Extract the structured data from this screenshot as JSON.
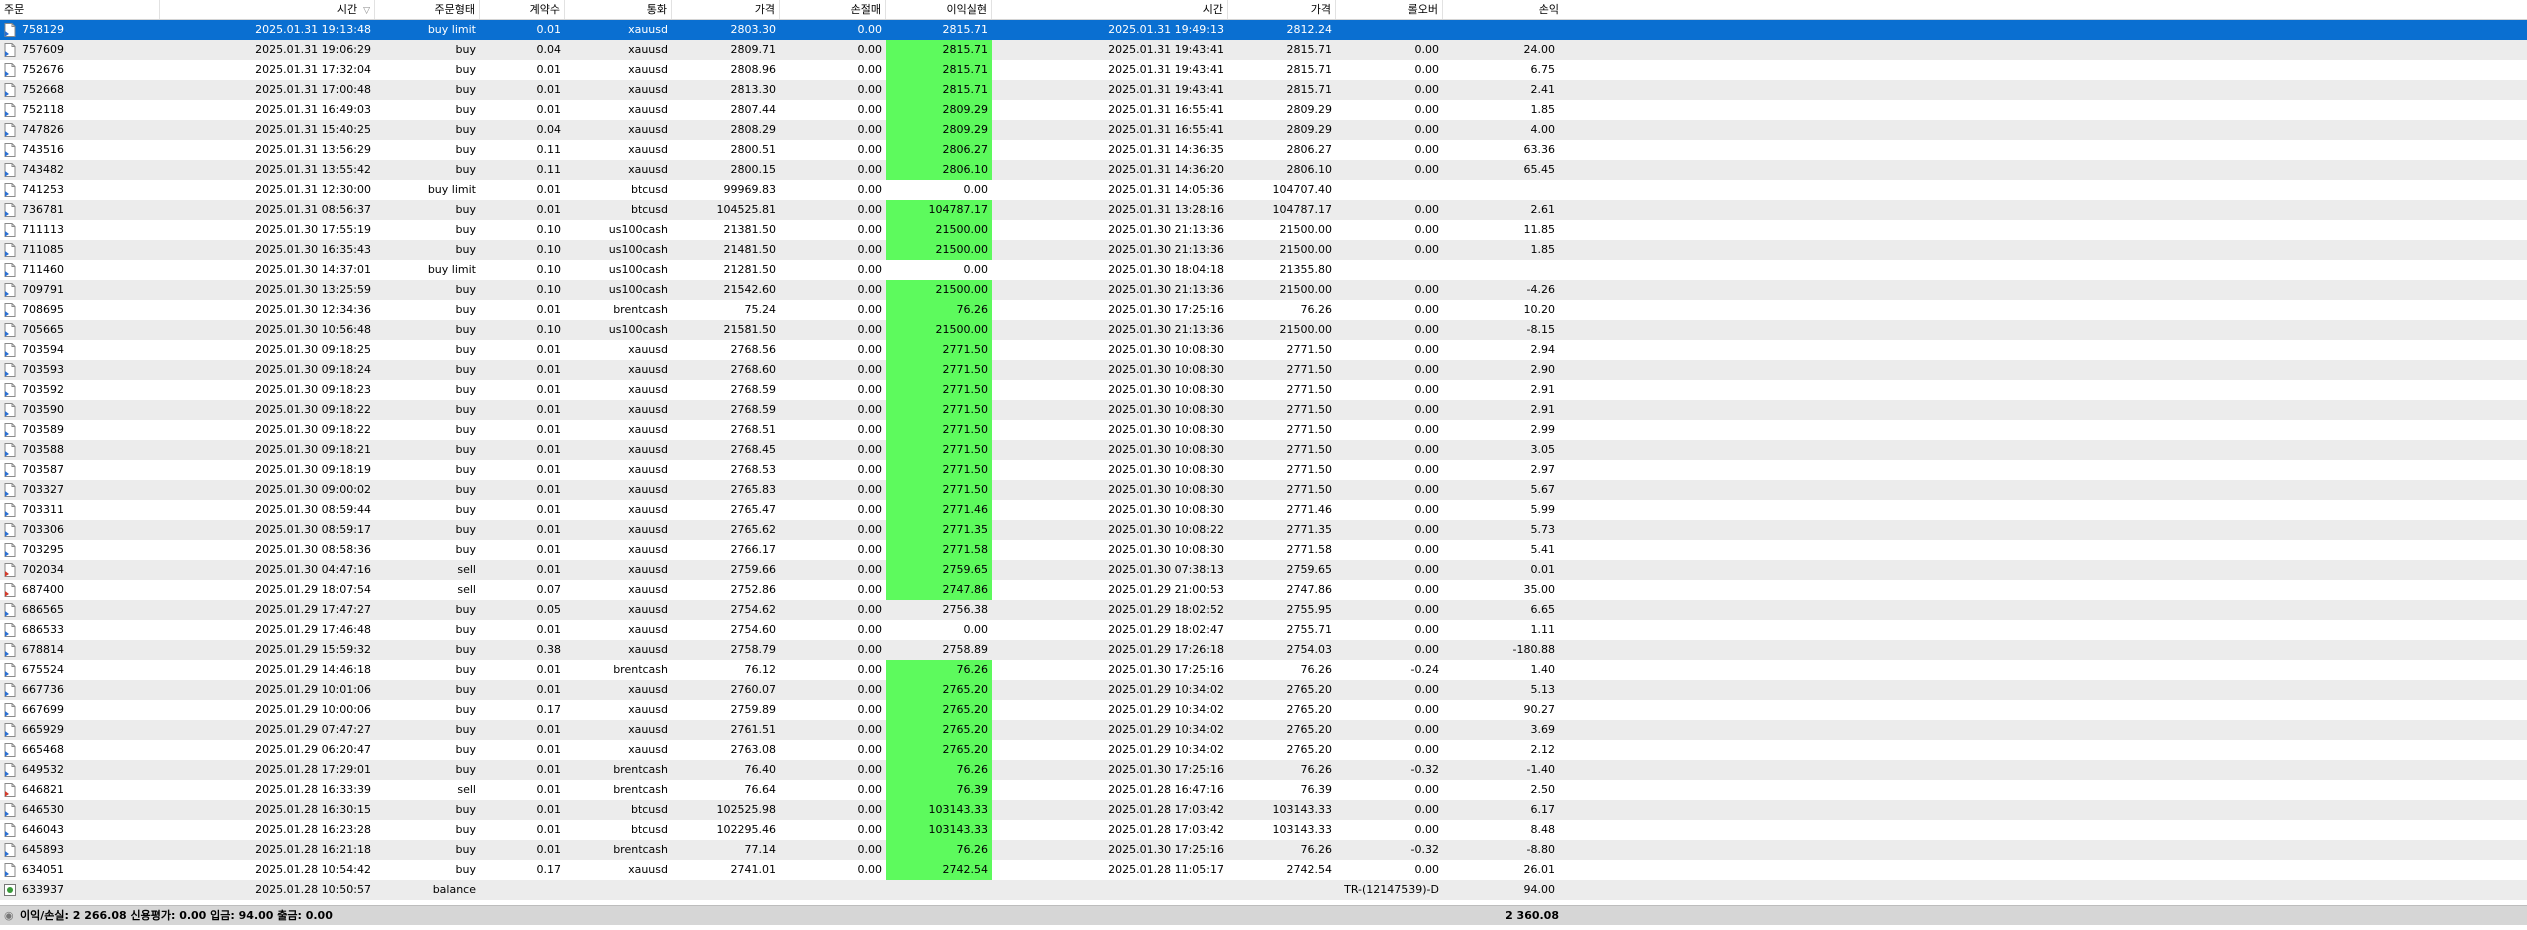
{
  "colors": {
    "selected": "#0a6fd1",
    "highlight": "#5dfa5d"
  },
  "headers": {
    "order": "주문",
    "time": "시간",
    "type": "주문형태",
    "volume": "계약수",
    "symbol": "통화",
    "price": "가격",
    "sl": "손절매",
    "tp": "이익실현",
    "close_time": "시간",
    "close_price": "가격",
    "swap": "롤오버",
    "profit": "손익"
  },
  "rows": [
    {
      "icon": "buy",
      "order": "758129",
      "time": "2025.01.31 19:13:48",
      "type": "buy limit",
      "volume": "0.01",
      "symbol": "xauusd",
      "price": "2803.30",
      "sl": "0.00",
      "tp": "2815.71",
      "tp_hl": true,
      "ct": "2025.01.31 19:49:13",
      "cp": "2812.24",
      "swap": "",
      "profit": "",
      "selected": true
    },
    {
      "icon": "buy",
      "order": "757609",
      "time": "2025.01.31 19:06:29",
      "type": "buy",
      "volume": "0.04",
      "symbol": "xauusd",
      "price": "2809.71",
      "sl": "0.00",
      "tp": "2815.71",
      "tp_hl": true,
      "ct": "2025.01.31 19:43:41",
      "cp": "2815.71",
      "swap": "0.00",
      "profit": "24.00"
    },
    {
      "icon": "buy",
      "order": "752676",
      "time": "2025.01.31 17:32:04",
      "type": "buy",
      "volume": "0.01",
      "symbol": "xauusd",
      "price": "2808.96",
      "sl": "0.00",
      "tp": "2815.71",
      "tp_hl": true,
      "ct": "2025.01.31 19:43:41",
      "cp": "2815.71",
      "swap": "0.00",
      "profit": "6.75"
    },
    {
      "icon": "buy",
      "order": "752668",
      "time": "2025.01.31 17:00:48",
      "type": "buy",
      "volume": "0.01",
      "symbol": "xauusd",
      "price": "2813.30",
      "sl": "0.00",
      "tp": "2815.71",
      "tp_hl": true,
      "ct": "2025.01.31 19:43:41",
      "cp": "2815.71",
      "swap": "0.00",
      "profit": "2.41"
    },
    {
      "icon": "buy",
      "order": "752118",
      "time": "2025.01.31 16:49:03",
      "type": "buy",
      "volume": "0.01",
      "symbol": "xauusd",
      "price": "2807.44",
      "sl": "0.00",
      "tp": "2809.29",
      "tp_hl": true,
      "ct": "2025.01.31 16:55:41",
      "cp": "2809.29",
      "swap": "0.00",
      "profit": "1.85"
    },
    {
      "icon": "buy",
      "order": "747826",
      "time": "2025.01.31 15:40:25",
      "type": "buy",
      "volume": "0.04",
      "symbol": "xauusd",
      "price": "2808.29",
      "sl": "0.00",
      "tp": "2809.29",
      "tp_hl": true,
      "ct": "2025.01.31 16:55:41",
      "cp": "2809.29",
      "swap": "0.00",
      "profit": "4.00"
    },
    {
      "icon": "buy",
      "order": "743516",
      "time": "2025.01.31 13:56:29",
      "type": "buy",
      "volume": "0.11",
      "symbol": "xauusd",
      "price": "2800.51",
      "sl": "0.00",
      "tp": "2806.27",
      "tp_hl": true,
      "ct": "2025.01.31 14:36:35",
      "cp": "2806.27",
      "swap": "0.00",
      "profit": "63.36"
    },
    {
      "icon": "buy",
      "order": "743482",
      "time": "2025.01.31 13:55:42",
      "type": "buy",
      "volume": "0.11",
      "symbol": "xauusd",
      "price": "2800.15",
      "sl": "0.00",
      "tp": "2806.10",
      "tp_hl": true,
      "ct": "2025.01.31 14:36:20",
      "cp": "2806.10",
      "swap": "0.00",
      "profit": "65.45"
    },
    {
      "icon": "buy",
      "order": "741253",
      "time": "2025.01.31 12:30:00",
      "type": "buy limit",
      "volume": "0.01",
      "symbol": "btcusd",
      "price": "99969.83",
      "sl": "0.00",
      "tp": "0.00",
      "tp_hl": false,
      "ct": "2025.01.31 14:05:36",
      "cp": "104707.40",
      "swap": "",
      "profit": ""
    },
    {
      "icon": "buy",
      "order": "736781",
      "time": "2025.01.31 08:56:37",
      "type": "buy",
      "volume": "0.01",
      "symbol": "btcusd",
      "price": "104525.81",
      "sl": "0.00",
      "tp": "104787.17",
      "tp_hl": true,
      "ct": "2025.01.31 13:28:16",
      "cp": "104787.17",
      "swap": "0.00",
      "profit": "2.61"
    },
    {
      "icon": "buy",
      "order": "711113",
      "time": "2025.01.30 17:55:19",
      "type": "buy",
      "volume": "0.10",
      "symbol": "us100cash",
      "price": "21381.50",
      "sl": "0.00",
      "tp": "21500.00",
      "tp_hl": true,
      "ct": "2025.01.30 21:13:36",
      "cp": "21500.00",
      "swap": "0.00",
      "profit": "11.85"
    },
    {
      "icon": "buy",
      "order": "711085",
      "time": "2025.01.30 16:35:43",
      "type": "buy",
      "volume": "0.10",
      "symbol": "us100cash",
      "price": "21481.50",
      "sl": "0.00",
      "tp": "21500.00",
      "tp_hl": true,
      "ct": "2025.01.30 21:13:36",
      "cp": "21500.00",
      "swap": "0.00",
      "profit": "1.85"
    },
    {
      "icon": "buy",
      "order": "711460",
      "time": "2025.01.30 14:37:01",
      "type": "buy limit",
      "volume": "0.10",
      "symbol": "us100cash",
      "price": "21281.50",
      "sl": "0.00",
      "tp": "0.00",
      "tp_hl": false,
      "ct": "2025.01.30 18:04:18",
      "cp": "21355.80",
      "swap": "",
      "profit": ""
    },
    {
      "icon": "buy",
      "order": "709791",
      "time": "2025.01.30 13:25:59",
      "type": "buy",
      "volume": "0.10",
      "symbol": "us100cash",
      "price": "21542.60",
      "sl": "0.00",
      "tp": "21500.00",
      "tp_hl": true,
      "ct": "2025.01.30 21:13:36",
      "cp": "21500.00",
      "swap": "0.00",
      "profit": "-4.26"
    },
    {
      "icon": "buy",
      "order": "708695",
      "time": "2025.01.30 12:34:36",
      "type": "buy",
      "volume": "0.01",
      "symbol": "brentcash",
      "price": "75.24",
      "sl": "0.00",
      "tp": "76.26",
      "tp_hl": true,
      "ct": "2025.01.30 17:25:16",
      "cp": "76.26",
      "swap": "0.00",
      "profit": "10.20"
    },
    {
      "icon": "buy",
      "order": "705665",
      "time": "2025.01.30 10:56:48",
      "type": "buy",
      "volume": "0.10",
      "symbol": "us100cash",
      "price": "21581.50",
      "sl": "0.00",
      "tp": "21500.00",
      "tp_hl": true,
      "ct": "2025.01.30 21:13:36",
      "cp": "21500.00",
      "swap": "0.00",
      "profit": "-8.15"
    },
    {
      "icon": "buy",
      "order": "703594",
      "time": "2025.01.30 09:18:25",
      "type": "buy",
      "volume": "0.01",
      "symbol": "xauusd",
      "price": "2768.56",
      "sl": "0.00",
      "tp": "2771.50",
      "tp_hl": true,
      "ct": "2025.01.30 10:08:30",
      "cp": "2771.50",
      "swap": "0.00",
      "profit": "2.94"
    },
    {
      "icon": "buy",
      "order": "703593",
      "time": "2025.01.30 09:18:24",
      "type": "buy",
      "volume": "0.01",
      "symbol": "xauusd",
      "price": "2768.60",
      "sl": "0.00",
      "tp": "2771.50",
      "tp_hl": true,
      "ct": "2025.01.30 10:08:30",
      "cp": "2771.50",
      "swap": "0.00",
      "profit": "2.90"
    },
    {
      "icon": "buy",
      "order": "703592",
      "time": "2025.01.30 09:18:23",
      "type": "buy",
      "volume": "0.01",
      "symbol": "xauusd",
      "price": "2768.59",
      "sl": "0.00",
      "tp": "2771.50",
      "tp_hl": true,
      "ct": "2025.01.30 10:08:30",
      "cp": "2771.50",
      "swap": "0.00",
      "profit": "2.91"
    },
    {
      "icon": "buy",
      "order": "703590",
      "time": "2025.01.30 09:18:22",
      "type": "buy",
      "volume": "0.01",
      "symbol": "xauusd",
      "price": "2768.59",
      "sl": "0.00",
      "tp": "2771.50",
      "tp_hl": true,
      "ct": "2025.01.30 10:08:30",
      "cp": "2771.50",
      "swap": "0.00",
      "profit": "2.91"
    },
    {
      "icon": "buy",
      "order": "703589",
      "time": "2025.01.30 09:18:22",
      "type": "buy",
      "volume": "0.01",
      "symbol": "xauusd",
      "price": "2768.51",
      "sl": "0.00",
      "tp": "2771.50",
      "tp_hl": true,
      "ct": "2025.01.30 10:08:30",
      "cp": "2771.50",
      "swap": "0.00",
      "profit": "2.99"
    },
    {
      "icon": "buy",
      "order": "703588",
      "time": "2025.01.30 09:18:21",
      "type": "buy",
      "volume": "0.01",
      "symbol": "xauusd",
      "price": "2768.45",
      "sl": "0.00",
      "tp": "2771.50",
      "tp_hl": true,
      "ct": "2025.01.30 10:08:30",
      "cp": "2771.50",
      "swap": "0.00",
      "profit": "3.05"
    },
    {
      "icon": "buy",
      "order": "703587",
      "time": "2025.01.30 09:18:19",
      "type": "buy",
      "volume": "0.01",
      "symbol": "xauusd",
      "price": "2768.53",
      "sl": "0.00",
      "tp": "2771.50",
      "tp_hl": true,
      "ct": "2025.01.30 10:08:30",
      "cp": "2771.50",
      "swap": "0.00",
      "profit": "2.97"
    },
    {
      "icon": "buy",
      "order": "703327",
      "time": "2025.01.30 09:00:02",
      "type": "buy",
      "volume": "0.01",
      "symbol": "xauusd",
      "price": "2765.83",
      "sl": "0.00",
      "tp": "2771.50",
      "tp_hl": true,
      "ct": "2025.01.30 10:08:30",
      "cp": "2771.50",
      "swap": "0.00",
      "profit": "5.67"
    },
    {
      "icon": "buy",
      "order": "703311",
      "time": "2025.01.30 08:59:44",
      "type": "buy",
      "volume": "0.01",
      "symbol": "xauusd",
      "price": "2765.47",
      "sl": "0.00",
      "tp": "2771.46",
      "tp_hl": true,
      "ct": "2025.01.30 10:08:30",
      "cp": "2771.46",
      "swap": "0.00",
      "profit": "5.99"
    },
    {
      "icon": "buy",
      "order": "703306",
      "time": "2025.01.30 08:59:17",
      "type": "buy",
      "volume": "0.01",
      "symbol": "xauusd",
      "price": "2765.62",
      "sl": "0.00",
      "tp": "2771.35",
      "tp_hl": true,
      "ct": "2025.01.30 10:08:22",
      "cp": "2771.35",
      "swap": "0.00",
      "profit": "5.73"
    },
    {
      "icon": "buy",
      "order": "703295",
      "time": "2025.01.30 08:58:36",
      "type": "buy",
      "volume": "0.01",
      "symbol": "xauusd",
      "price": "2766.17",
      "sl": "0.00",
      "tp": "2771.58",
      "tp_hl": true,
      "ct": "2025.01.30 10:08:30",
      "cp": "2771.58",
      "swap": "0.00",
      "profit": "5.41"
    },
    {
      "icon": "sell",
      "order": "702034",
      "time": "2025.01.30 04:47:16",
      "type": "sell",
      "volume": "0.01",
      "symbol": "xauusd",
      "price": "2759.66",
      "sl": "0.00",
      "tp": "2759.65",
      "tp_hl": true,
      "ct": "2025.01.30 07:38:13",
      "cp": "2759.65",
      "swap": "0.00",
      "profit": "0.01"
    },
    {
      "icon": "sell",
      "order": "687400",
      "time": "2025.01.29 18:07:54",
      "type": "sell",
      "volume": "0.07",
      "symbol": "xauusd",
      "price": "2752.86",
      "sl": "0.00",
      "tp": "2747.86",
      "tp_hl": true,
      "ct": "2025.01.29 21:00:53",
      "cp": "2747.86",
      "swap": "0.00",
      "profit": "35.00"
    },
    {
      "icon": "buy",
      "order": "686565",
      "time": "2025.01.29 17:47:27",
      "type": "buy",
      "volume": "0.05",
      "symbol": "xauusd",
      "price": "2754.62",
      "sl": "0.00",
      "tp": "2756.38",
      "tp_hl": false,
      "ct": "2025.01.29 18:02:52",
      "cp": "2755.95",
      "swap": "0.00",
      "profit": "6.65"
    },
    {
      "icon": "buy",
      "order": "686533",
      "time": "2025.01.29 17:46:48",
      "type": "buy",
      "volume": "0.01",
      "symbol": "xauusd",
      "price": "2754.60",
      "sl": "0.00",
      "tp": "0.00",
      "tp_hl": false,
      "ct": "2025.01.29 18:02:47",
      "cp": "2755.71",
      "swap": "0.00",
      "profit": "1.11"
    },
    {
      "icon": "buy",
      "order": "678814",
      "time": "2025.01.29 15:59:32",
      "type": "buy",
      "volume": "0.38",
      "symbol": "xauusd",
      "price": "2758.79",
      "sl": "0.00",
      "tp": "2758.89",
      "tp_hl": false,
      "ct": "2025.01.29 17:26:18",
      "cp": "2754.03",
      "swap": "0.00",
      "profit": "-180.88"
    },
    {
      "icon": "buy",
      "order": "675524",
      "time": "2025.01.29 14:46:18",
      "type": "buy",
      "volume": "0.01",
      "symbol": "brentcash",
      "price": "76.12",
      "sl": "0.00",
      "tp": "76.26",
      "tp_hl": true,
      "ct": "2025.01.30 17:25:16",
      "cp": "76.26",
      "swap": "-0.24",
      "profit": "1.40"
    },
    {
      "icon": "buy",
      "order": "667736",
      "time": "2025.01.29 10:01:06",
      "type": "buy",
      "volume": "0.01",
      "symbol": "xauusd",
      "price": "2760.07",
      "sl": "0.00",
      "tp": "2765.20",
      "tp_hl": true,
      "ct": "2025.01.29 10:34:02",
      "cp": "2765.20",
      "swap": "0.00",
      "profit": "5.13"
    },
    {
      "icon": "buy",
      "order": "667699",
      "time": "2025.01.29 10:00:06",
      "type": "buy",
      "volume": "0.17",
      "symbol": "xauusd",
      "price": "2759.89",
      "sl": "0.00",
      "tp": "2765.20",
      "tp_hl": true,
      "ct": "2025.01.29 10:34:02",
      "cp": "2765.20",
      "swap": "0.00",
      "profit": "90.27"
    },
    {
      "icon": "buy",
      "order": "665929",
      "time": "2025.01.29 07:47:27",
      "type": "buy",
      "volume": "0.01",
      "symbol": "xauusd",
      "price": "2761.51",
      "sl": "0.00",
      "tp": "2765.20",
      "tp_hl": true,
      "ct": "2025.01.29 10:34:02",
      "cp": "2765.20",
      "swap": "0.00",
      "profit": "3.69"
    },
    {
      "icon": "buy",
      "order": "665468",
      "time": "2025.01.29 06:20:47",
      "type": "buy",
      "volume": "0.01",
      "symbol": "xauusd",
      "price": "2763.08",
      "sl": "0.00",
      "tp": "2765.20",
      "tp_hl": true,
      "ct": "2025.01.29 10:34:02",
      "cp": "2765.20",
      "swap": "0.00",
      "profit": "2.12"
    },
    {
      "icon": "buy",
      "order": "649532",
      "time": "2025.01.28 17:29:01",
      "type": "buy",
      "volume": "0.01",
      "symbol": "brentcash",
      "price": "76.40",
      "sl": "0.00",
      "tp": "76.26",
      "tp_hl": true,
      "ct": "2025.01.30 17:25:16",
      "cp": "76.26",
      "swap": "-0.32",
      "profit": "-1.40"
    },
    {
      "icon": "sell",
      "order": "646821",
      "time": "2025.01.28 16:33:39",
      "type": "sell",
      "volume": "0.01",
      "symbol": "brentcash",
      "price": "76.64",
      "sl": "0.00",
      "tp": "76.39",
      "tp_hl": true,
      "ct": "2025.01.28 16:47:16",
      "cp": "76.39",
      "swap": "0.00",
      "profit": "2.50"
    },
    {
      "icon": "buy",
      "order": "646530",
      "time": "2025.01.28 16:30:15",
      "type": "buy",
      "volume": "0.01",
      "symbol": "btcusd",
      "price": "102525.98",
      "sl": "0.00",
      "tp": "103143.33",
      "tp_hl": true,
      "ct": "2025.01.28 17:03:42",
      "cp": "103143.33",
      "swap": "0.00",
      "profit": "6.17"
    },
    {
      "icon": "buy",
      "order": "646043",
      "time": "2025.01.28 16:23:28",
      "type": "buy",
      "volume": "0.01",
      "symbol": "btcusd",
      "price": "102295.46",
      "sl": "0.00",
      "tp": "103143.33",
      "tp_hl": true,
      "ct": "2025.01.28 17:03:42",
      "cp": "103143.33",
      "swap": "0.00",
      "profit": "8.48"
    },
    {
      "icon": "buy",
      "order": "645893",
      "time": "2025.01.28 16:21:18",
      "type": "buy",
      "volume": "0.01",
      "symbol": "brentcash",
      "price": "77.14",
      "sl": "0.00",
      "tp": "76.26",
      "tp_hl": true,
      "ct": "2025.01.30 17:25:16",
      "cp": "76.26",
      "swap": "-0.32",
      "profit": "-8.80"
    },
    {
      "icon": "buy",
      "order": "634051",
      "time": "2025.01.28 10:54:42",
      "type": "buy",
      "volume": "0.17",
      "symbol": "xauusd",
      "price": "2741.01",
      "sl": "0.00",
      "tp": "2742.54",
      "tp_hl": true,
      "ct": "2025.01.28 11:05:17",
      "cp": "2742.54",
      "swap": "0.00",
      "profit": "26.01"
    },
    {
      "icon": "balance",
      "order": "633937",
      "time": "2025.01.28 10:50:57",
      "type": "balance",
      "volume": "",
      "symbol": "",
      "price": "",
      "sl": "",
      "tp": "",
      "tp_hl": false,
      "ct": "",
      "cp": "",
      "swap": "TR-(12147539)-D",
      "profit": "94.00"
    }
  ],
  "footer": {
    "summary": "이익/손실: 2 266.08   신용평가: 0.00   입금: 94.00   출금: 0.00",
    "total": "2 360.08"
  }
}
